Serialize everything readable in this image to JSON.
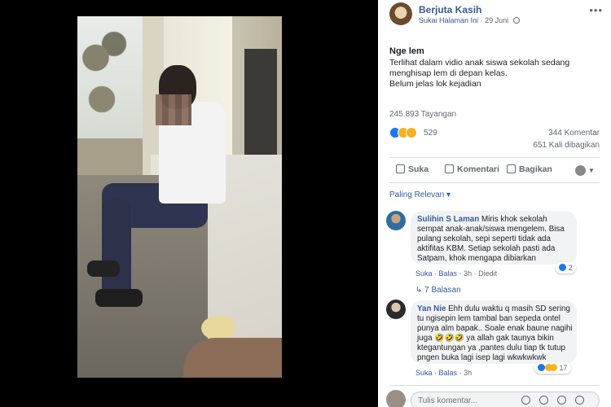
{
  "post": {
    "author": "Berjuta Kasih",
    "page_link": "Sukai Halaman Ini",
    "date": "29 Juni",
    "more": "•••",
    "title": "Nge lem",
    "body_lines": [
      "Terlihat dalam vidio anak siswa sekolah sedang",
      "menghisap lem di depan kelas.",
      "Belum jelas lok kejadian"
    ],
    "views": "245.893 Tayangan",
    "reaction_count": "529",
    "comments_count": "344 Komentar",
    "shares_count": "651 Kali dibagikan"
  },
  "actions": {
    "like": "Suka",
    "comment": "Komentari",
    "share": "Bagikan"
  },
  "sort_label": "Paling Relevan ▾",
  "comments": [
    {
      "name": "Sulihin S Laman",
      "text_lines": [
        "Miris khok sekolah",
        "sempat anak-anak/siswa mengelem. Bisa",
        "pulang sekolah, sepi seperti tidak ada",
        "aktifitas KBM. Setiap sekolah pasti ada",
        "Satpam, khok mengapa dibiarkan"
      ],
      "like": "Suka",
      "reply": "Balas",
      "time": "3h",
      "edited": "Diedit",
      "reactions": "2",
      "replies": "↳ 7 Balasan"
    },
    {
      "name": "Yan Nie",
      "text_lines": [
        "Ehh dulu waktu q masih SD sering",
        "tu ngisepin lem tambal ban sepeda ontel",
        "punya alm bapak.. Soale enak baune nagihi",
        "juga 🤣🤣🤣 ya allah gak taunya bikin",
        "ktegantungan ya ,pantes dulu tiap tk tutup",
        "pngen buka lagi isep lagi wkwkwkwk"
      ],
      "like": "Suka",
      "reply": "Balas",
      "time": "3h",
      "reactions": "17"
    }
  ],
  "input": {
    "placeholder": "Tulis komentar..."
  },
  "icons": {
    "globe": "globe-icon",
    "like": "thumbs-up-icon",
    "comment": "comment-icon",
    "share": "share-icon"
  }
}
